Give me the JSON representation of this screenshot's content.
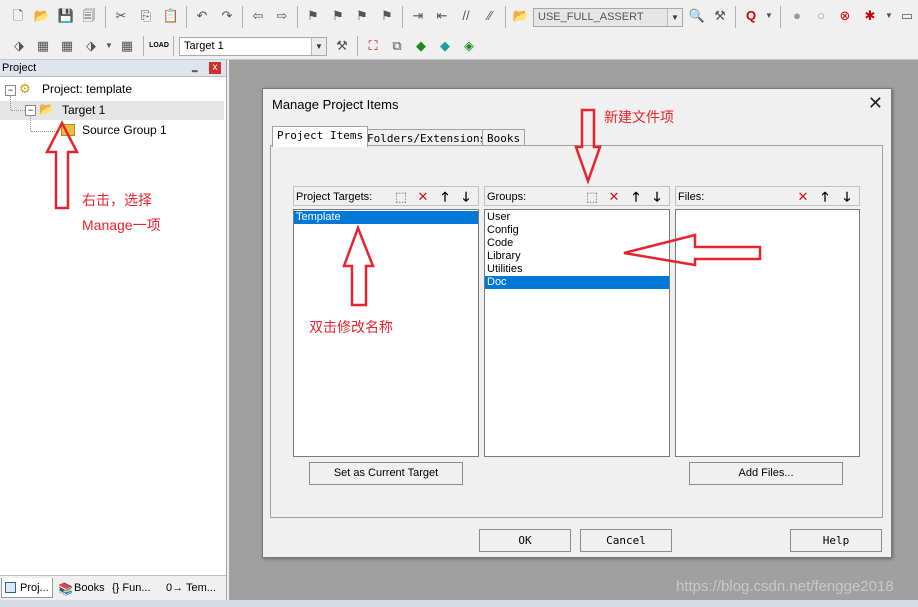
{
  "toolbar": {
    "define_combo": "USE_FULL_ASSERT",
    "target_combo": "Target 1",
    "load_label": "LOAD"
  },
  "project_panel": {
    "title": "Project",
    "pin": "‗",
    "close": "x",
    "tree": {
      "project": "Project: template",
      "target": "Target 1",
      "group": "Source Group 1"
    },
    "bottom_tabs": [
      "Proj...",
      "Books",
      "{} Fun...",
      "0→ Tem..."
    ]
  },
  "dialog": {
    "title": "Manage Project Items",
    "close": "✕",
    "tabs": [
      "Project Items",
      "Folders/Extensions",
      "Books"
    ],
    "targets": {
      "header": "Project Targets:",
      "items": [
        "Template"
      ],
      "selected": 0,
      "button": "Set as Current Target"
    },
    "groups": {
      "header": "Groups:",
      "items": [
        "User",
        "Config",
        "Code",
        "Library",
        "Utilities",
        "Doc"
      ],
      "selected": 5
    },
    "files": {
      "header": "Files:",
      "items": [],
      "button": "Add Files..."
    },
    "ok": "OK",
    "cancel": "Cancel",
    "help": "Help"
  },
  "annotations": {
    "right_click_line1": "右击，选择",
    "right_click_line2": "Manage一项",
    "new_file": "新建文件项",
    "rename": "双击修改名称"
  },
  "watermark": "https://blog.csdn.net/fengge2018",
  "colors": {
    "selection": "#0078d7",
    "annotation_red": "#e8232d",
    "delete_red": "#d01010"
  }
}
